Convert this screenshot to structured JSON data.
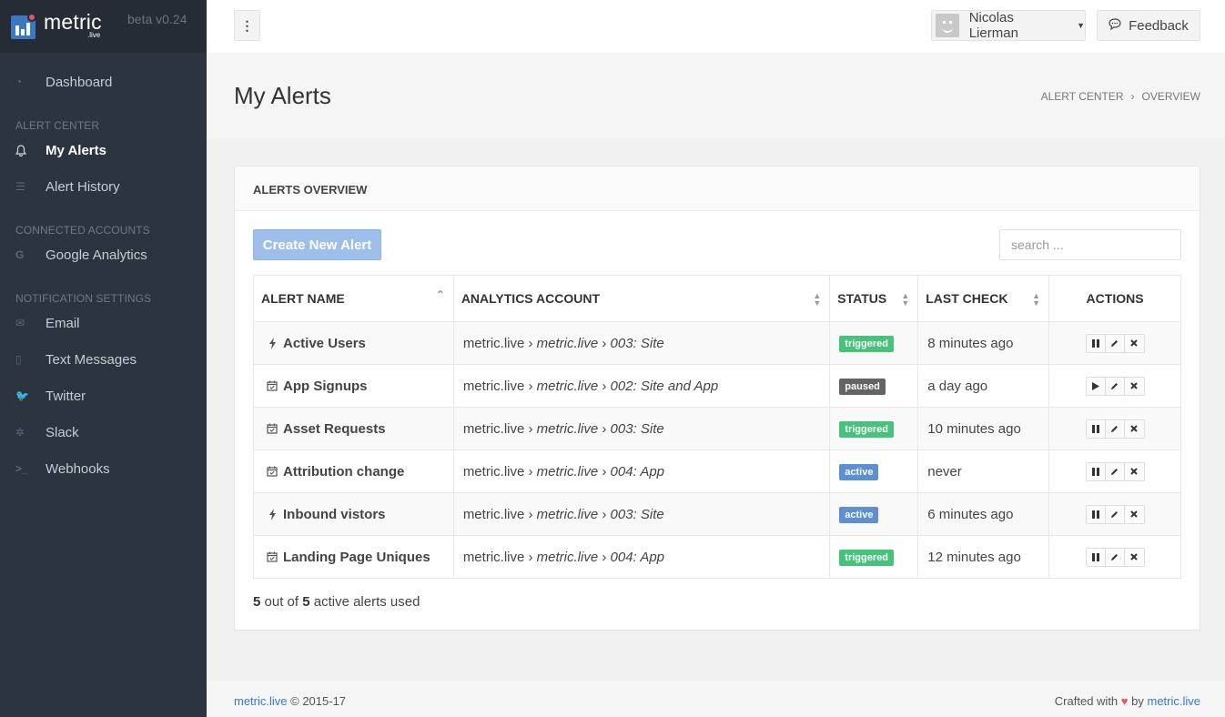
{
  "brand": {
    "name": "metric",
    "sub": ".live",
    "version": "beta v0.24"
  },
  "sidebar": {
    "dashboard": "Dashboard",
    "sections": [
      {
        "title": "ALERT CENTER",
        "items": [
          "My Alerts",
          "Alert History"
        ]
      },
      {
        "title": "CONNECTED ACCOUNTS",
        "items": [
          "Google Analytics"
        ]
      },
      {
        "title": "NOTIFICATION SETTINGS",
        "items": [
          "Email",
          "Text Messages",
          "Twitter",
          "Slack",
          "Webhooks"
        ]
      }
    ],
    "active_item": "My Alerts"
  },
  "topbar": {
    "menu_icon": "⋮",
    "user_name": "Nicolas Lierman",
    "feedback_label": "Feedback"
  },
  "page": {
    "title": "My Alerts",
    "breadcrumb": [
      "ALERT CENTER",
      "OVERVIEW"
    ]
  },
  "panel": {
    "title": "ALERTS OVERVIEW",
    "create_label": "Create New Alert",
    "search_placeholder": "search ...",
    "columns": [
      "ALERT NAME",
      "ANALYTICS ACCOUNT",
      "STATUS",
      "LAST CHECK",
      "ACTIONS"
    ],
    "rows": [
      {
        "icon": "bolt-icon",
        "name": "Active Users",
        "acc1": "metric.live",
        "acc2": "metric.live",
        "acc3": "003: Site",
        "status": "triggered",
        "last": "8 minutes ago",
        "playing": true
      },
      {
        "icon": "calendar-icon",
        "name": "App Signups",
        "acc1": "metric.live",
        "acc2": "metric.live",
        "acc3": "002: Site and App",
        "status": "paused",
        "last": "a day ago",
        "playing": false
      },
      {
        "icon": "calendar-icon",
        "name": "Asset Requests",
        "acc1": "metric.live",
        "acc2": "metric.live",
        "acc3": "003: Site",
        "status": "triggered",
        "last": "10 minutes ago",
        "playing": true
      },
      {
        "icon": "calendar-icon",
        "name": "Attribution change",
        "acc1": "metric.live",
        "acc2": "metric.live",
        "acc3": "004: App",
        "status": "active",
        "last": "never",
        "playing": true
      },
      {
        "icon": "bolt-icon",
        "name": "Inbound vistors",
        "acc1": "metric.live",
        "acc2": "metric.live",
        "acc3": "003: Site",
        "status": "active",
        "last": "6 minutes ago",
        "playing": true
      },
      {
        "icon": "calendar-icon",
        "name": "Landing Page Uniques",
        "acc1": "metric.live",
        "acc2": "metric.live",
        "acc3": "004: App",
        "status": "triggered",
        "last": "12 minutes ago",
        "playing": true
      }
    ],
    "usage": {
      "used": "5",
      "middle": " out of ",
      "total": "5",
      "suffix": " active alerts used"
    }
  },
  "status_colors": {
    "triggered": "#46c37b",
    "paused": "#646464",
    "active": "#5c90d2"
  },
  "footer": {
    "brand_link": "metric.live",
    "copyright": " © 2015-17",
    "crafted": "Crafted with",
    "by": " by ",
    "by_link": "metric.live"
  }
}
